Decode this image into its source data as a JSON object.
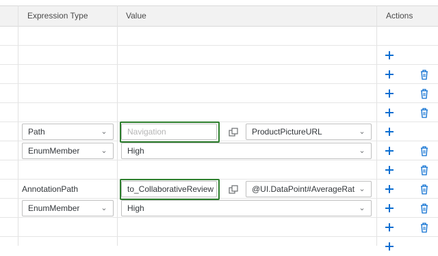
{
  "columns": {
    "expression_type": "Expression Type",
    "value": "Value",
    "actions": "Actions"
  },
  "rows": [
    {
      "expr": "",
      "value": "",
      "path": ""
    },
    {
      "expr": "",
      "value": "",
      "path": ""
    },
    {
      "expr": "",
      "value": "",
      "path": ""
    },
    {
      "expr": "",
      "value": "",
      "path": ""
    },
    {
      "expr": "Path",
      "value_placeholder": "Navigation",
      "path": "ProductPictureURL"
    },
    {
      "expr": "EnumMember",
      "value": "High"
    },
    {
      "expr": "",
      "value": ""
    },
    {
      "expr": "AnnotationPath",
      "value": "to_CollaborativeReview",
      "path": "@UI.DataPoint#AverageRatin..."
    },
    {
      "expr": "EnumMember",
      "value": "High"
    },
    {
      "expr": "",
      "value": ""
    }
  ],
  "icons": {
    "add": "plus-icon",
    "delete": "trash-icon",
    "value_help": "value-help-icon",
    "dropdown": "chevron-down-icon"
  },
  "colors": {
    "accent": "#0a6ed1",
    "highlight": "#2b7d2b",
    "header_bg": "#f2f2f2"
  }
}
